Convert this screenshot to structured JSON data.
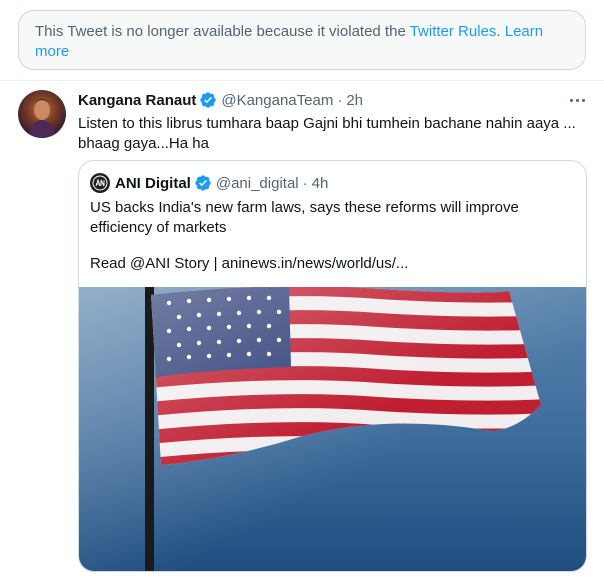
{
  "notice": {
    "text": "This Tweet is no longer available because it violated the ",
    "link_rules": "Twitter Rules",
    "link_learn": "Learn more",
    "link_color": "#1d9bf0"
  },
  "tweet": {
    "name": "Kangana Ranaut",
    "handle": "@KanganaTeam",
    "separator": "·",
    "time": "2h",
    "text": "Listen to this librus tumhara baap Gajni bhi tumhein bachane nahin aaya ... bhaag gaya...Ha ha",
    "verified": true,
    "more_icon": "more-horizontal-icon"
  },
  "quote": {
    "name": "ANI Digital",
    "handle": "@ani_digital",
    "separator": "·",
    "time": "4h",
    "text": "US backs India's new farm laws, says these reforms will improve efficiency of markets",
    "link_line": "Read @ANI Story | aninews.in/news/world/us/...",
    "verified": true,
    "media": "american-flag-photo"
  },
  "colors": {
    "verified_badge": "#1d9bf0",
    "text_primary": "#0f1419",
    "text_secondary": "#536471",
    "border": "#cfd9de"
  }
}
